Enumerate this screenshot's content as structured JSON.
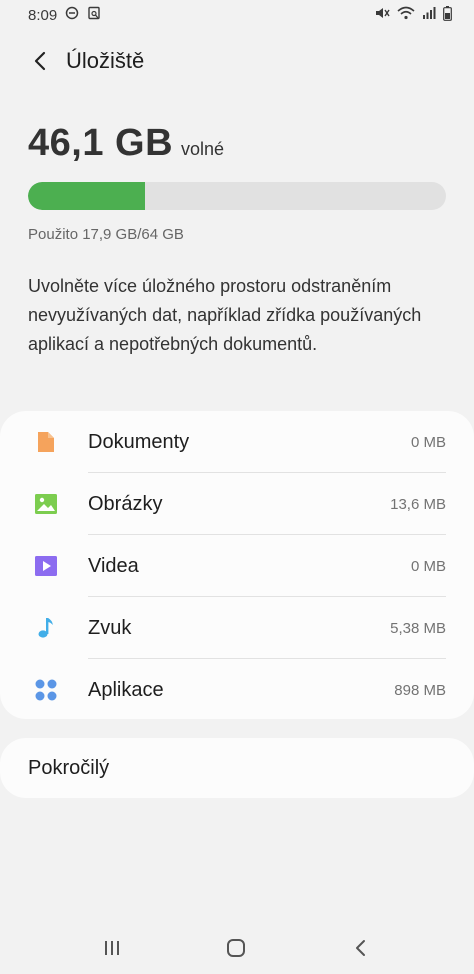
{
  "status_bar": {
    "time": "8:09",
    "left_icons": [
      "dnd-icon",
      "screenshot-icon"
    ],
    "right_icons": [
      "mute-icon",
      "wifi-icon",
      "signal-icon",
      "battery-icon"
    ]
  },
  "app_bar": {
    "title": "Úložiště"
  },
  "storage": {
    "free_amount": "46,1 GB",
    "free_label": "volné",
    "used_fraction": 0.28,
    "used_text": "Použito 17,9 GB/64 GB",
    "bar_color": "#4caf50"
  },
  "description": "Uvolněte více úložného prostoru odstraněním nevyužívaných dat, například zřídka používaných aplikací a nepotřebných dokumentů.",
  "categories": [
    {
      "label": "Dokumenty",
      "size": "0 MB",
      "icon": "document-icon",
      "color": "#f5a35c"
    },
    {
      "label": "Obrázky",
      "size": "13,6 MB",
      "icon": "image-icon",
      "color": "#7ccd4f"
    },
    {
      "label": "Videa",
      "size": "0 MB",
      "icon": "video-icon",
      "color": "#8c6cf0"
    },
    {
      "label": "Zvuk",
      "size": "5,38 MB",
      "icon": "music-icon",
      "color": "#42aee8"
    },
    {
      "label": "Aplikace",
      "size": "898 MB",
      "icon": "apps-icon",
      "color": "#5b96e6"
    }
  ],
  "advanced": {
    "label": "Pokročilý"
  },
  "nav_bar": {
    "buttons": [
      "recents-icon",
      "home-icon",
      "back-icon"
    ]
  }
}
